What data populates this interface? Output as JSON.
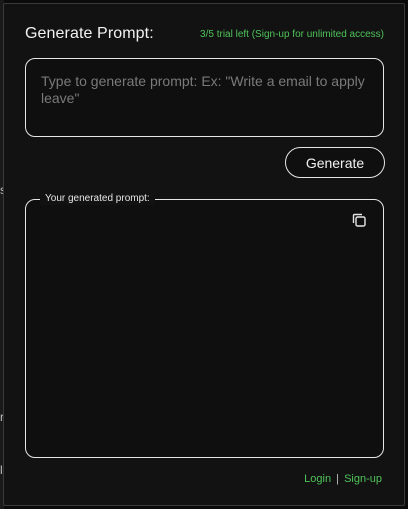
{
  "header": {
    "title": "Generate Prompt:",
    "trial_note": "3/5 trial left (Sign-up for unlimited access)"
  },
  "input": {
    "value": "",
    "placeholder": "Type to generate prompt: Ex: \"Write a email to apply leave\""
  },
  "generate_button": {
    "label": "Generate"
  },
  "output": {
    "legend": "Your generated prompt:",
    "value": "",
    "copy_icon": "copy-icon"
  },
  "footer": {
    "login": "Login",
    "separator": "|",
    "signup": "Sign-up"
  },
  "colors": {
    "accent_green": "#4fc35a",
    "background": "#121212",
    "border": "#e6e6e6"
  }
}
